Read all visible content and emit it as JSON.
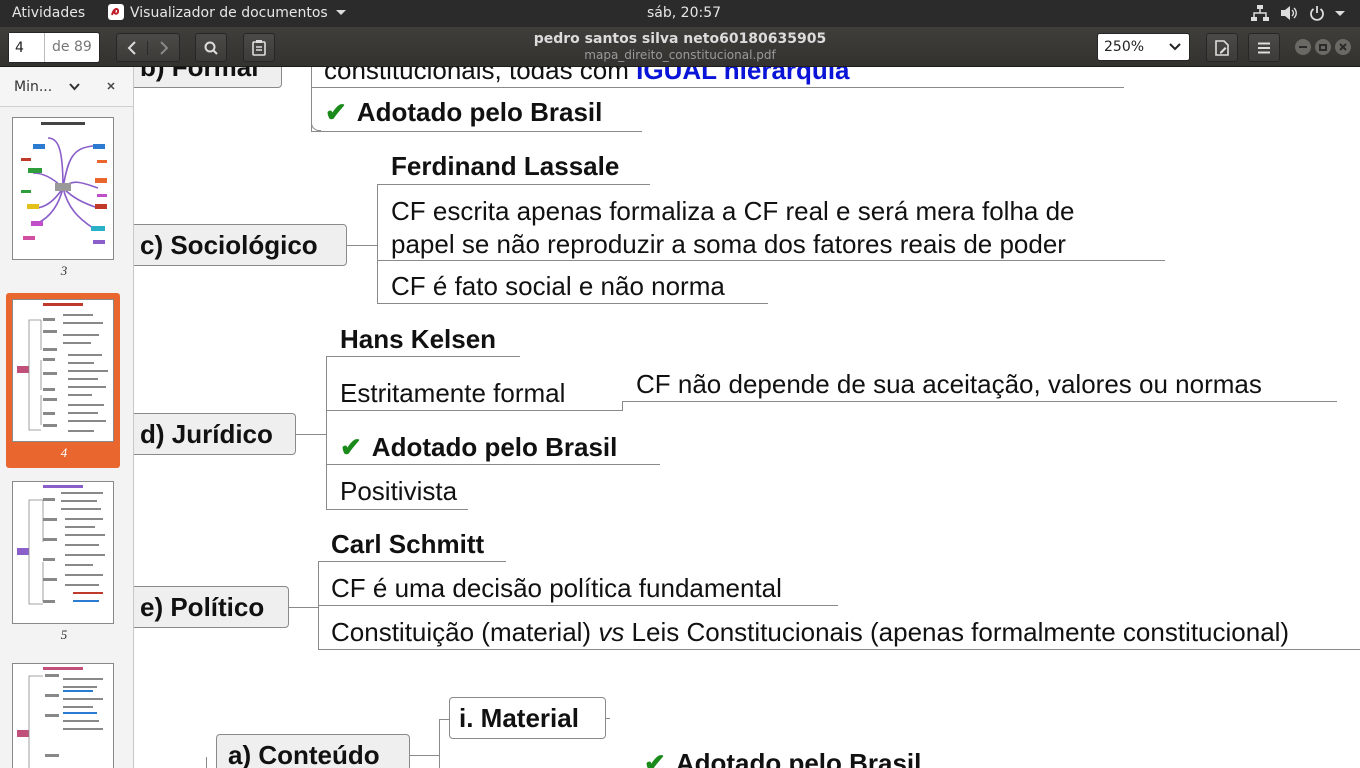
{
  "topbar": {
    "activities": "Atividades",
    "app_menu": "Visualizador de documentos",
    "clock": "sáb, 20:57"
  },
  "header": {
    "page_input": "4",
    "page_total": "de 89",
    "title": "pedro santos silva neto60180635905",
    "subtitle": "mapa_direito_constitucional.pdf",
    "zoom": "250%"
  },
  "sidebar": {
    "mode_label": "Min...",
    "thumbnails": [
      {
        "label": "3",
        "selected": false
      },
      {
        "label": "4",
        "selected": true
      },
      {
        "label": "5",
        "selected": false
      },
      {
        "label": "",
        "selected": false
      }
    ]
  },
  "document": {
    "formal_node": "b) Formal",
    "formal_line_prefix": "constitucionais, todas com ",
    "formal_line_emph": "IGUAL hierarquia",
    "formal_adopted": "Adotado pelo Brasil",
    "sociologico_node": "c) Sociológico",
    "lassale": "Ferdinand Lassale",
    "lassale_desc_1": "CF escrita apenas formaliza a CF real e será mera folha de",
    "lassale_desc_2": "papel se não reproduzir a soma dos fatores reais de poder",
    "lassale_fact": "CF é fato social e não norma",
    "juridico_node": "d) Jurídico",
    "kelsen": "Hans Kelsen",
    "estritamente": "Estritamente formal",
    "estritamente_desc": "CF não depende de sua aceitação, valores ou normas",
    "juridico_adopted": "Adotado pelo Brasil",
    "positivista": "Positivista",
    "politico_node": "e) Político",
    "schmitt": "Carl Schmitt",
    "schmitt_desc": "CF é uma decisão política fundamental",
    "schmitt_line_1": "Constituição (material) ",
    "schmitt_line_vs": "vs",
    "schmitt_line_2": " Leis Constitucionais (apenas formalmente constitucional)",
    "conteudo_node": "a) Conteúdo",
    "material_node": "i. Material",
    "material_adopted": "Adotado pelo Brasil"
  },
  "icons": [
    "evince-app-icon",
    "caret-down-icon",
    "network-icon",
    "volume-icon",
    "power-icon",
    "chevron-left-icon",
    "chevron-right-icon",
    "search-icon",
    "clipboard-icon",
    "annotate-icon",
    "hamburger-icon",
    "window-minimize-icon",
    "window-maximize-icon",
    "window-close-icon",
    "close-icon",
    "check-icon"
  ],
  "colors": {
    "accent_orange": "#e9672e",
    "emphasis_blue": "#0a14d6",
    "check_green": "#1a8a1a"
  }
}
